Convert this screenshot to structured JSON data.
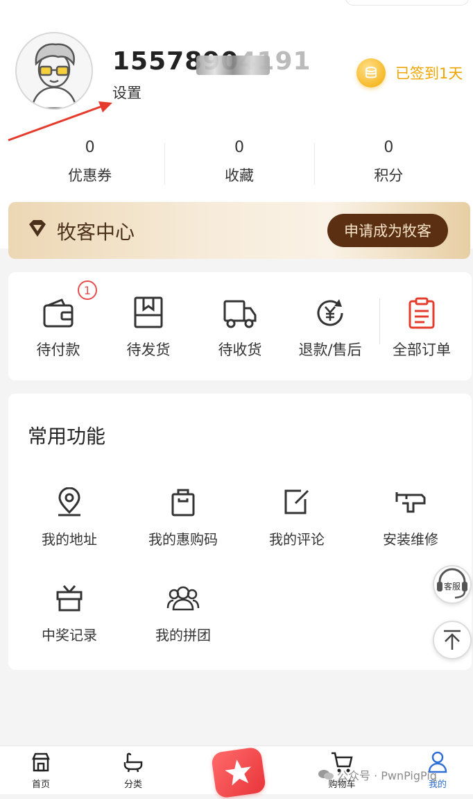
{
  "profile": {
    "phone": "1557890",
    "phone_masked_suffix": "4191",
    "settings_label": "设置",
    "checkin_text": "已签到1天"
  },
  "stats": [
    {
      "value": "0",
      "label": "优惠券"
    },
    {
      "value": "0",
      "label": "收藏"
    },
    {
      "value": "0",
      "label": "积分"
    }
  ],
  "herder_center": {
    "title": "牧客中心",
    "button": "申请成为牧客"
  },
  "orders": {
    "items": [
      {
        "label": "待付款",
        "icon": "wallet-icon",
        "badge": "1"
      },
      {
        "label": "待发货",
        "icon": "package-icon"
      },
      {
        "label": "待收货",
        "icon": "truck-icon"
      },
      {
        "label": "退款/售后",
        "icon": "refund-icon"
      },
      {
        "label": "全部订单",
        "icon": "order-list-icon"
      }
    ]
  },
  "functions": {
    "title": "常用功能",
    "items": [
      {
        "label": "我的地址",
        "icon": "location-pin-icon"
      },
      {
        "label": "我的惠购码",
        "icon": "shopping-bag-icon"
      },
      {
        "label": "我的评论",
        "icon": "edit-icon"
      },
      {
        "label": "安装维修",
        "icon": "wrench-icon"
      },
      {
        "label": "中奖记录",
        "icon": "gift-icon"
      },
      {
        "label": "我的拼团",
        "icon": "group-icon"
      }
    ]
  },
  "floating": {
    "service_label": "客服",
    "top_icon": "arrow-up-icon"
  },
  "tabbar": {
    "items": [
      {
        "label": "首页",
        "icon": "store-icon"
      },
      {
        "label": "分类",
        "icon": "category-icon"
      },
      {
        "label": "",
        "icon": "star-icon"
      },
      {
        "label": "购物车",
        "icon": "cart-icon"
      },
      {
        "label": "我的",
        "icon": "user-icon",
        "active": true
      }
    ]
  },
  "watermark": "公众号 · PwnPigPig",
  "colors": {
    "accent_gold": "#f0a400",
    "herder_button": "#5b3012",
    "badge_red": "#e74c4c",
    "active_tab": "#2f6fd6"
  }
}
